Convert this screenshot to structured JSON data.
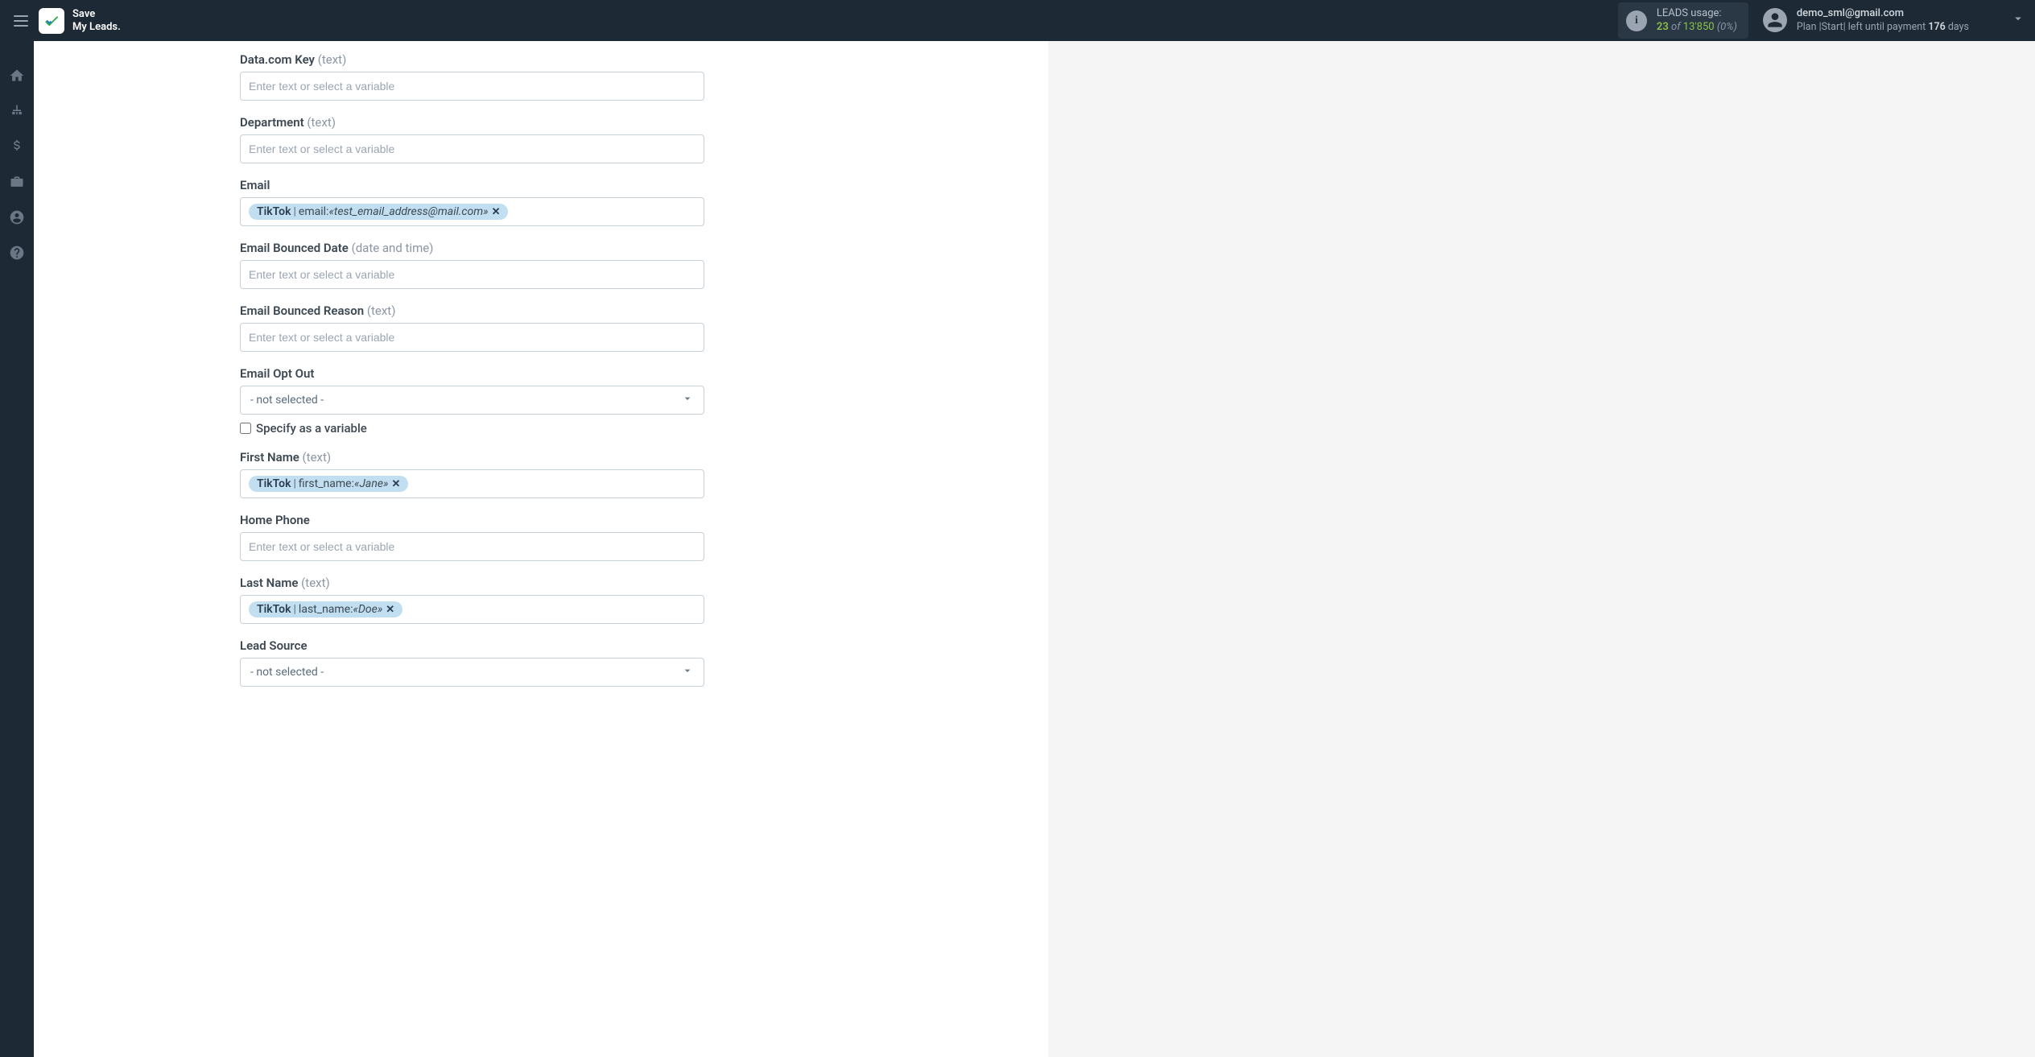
{
  "brand": {
    "line1": "Save",
    "line2": "My Leads."
  },
  "usage": {
    "label": "LEADS usage:",
    "used": "23",
    "of": "of",
    "total": "13'850",
    "pct": "(0%)"
  },
  "user": {
    "email": "demo_sml@gmail.com",
    "plan_prefix": "Plan |Start| left until payment ",
    "days": "176",
    "days_suffix": " days"
  },
  "placeholder": "Enter text or select a variable",
  "not_selected": "- not selected -",
  "specify_var": "Specify as a variable",
  "fields": {
    "datacom": {
      "label": "Data.com Key ",
      "type": "(text)"
    },
    "department": {
      "label": "Department ",
      "type": "(text)"
    },
    "email": {
      "label": "Email",
      "tag_source": "TikTok",
      "tag_field": "email:",
      "tag_value": "«test_email_address@mail.com»"
    },
    "bounced_date": {
      "label": "Email Bounced Date ",
      "type": "(date and time)"
    },
    "bounced_reason": {
      "label": "Email Bounced Reason ",
      "type": "(text)"
    },
    "opt_out": {
      "label": "Email Opt Out"
    },
    "first_name": {
      "label": "First Name ",
      "type": "(text)",
      "tag_source": "TikTok",
      "tag_field": "first_name:",
      "tag_value": "«Jane»"
    },
    "home_phone": {
      "label": "Home Phone"
    },
    "last_name": {
      "label": "Last Name ",
      "type": "(text)",
      "tag_source": "TikTok",
      "tag_field": "last_name:",
      "tag_value": "«Doe»"
    },
    "lead_source": {
      "label": "Lead Source"
    }
  }
}
